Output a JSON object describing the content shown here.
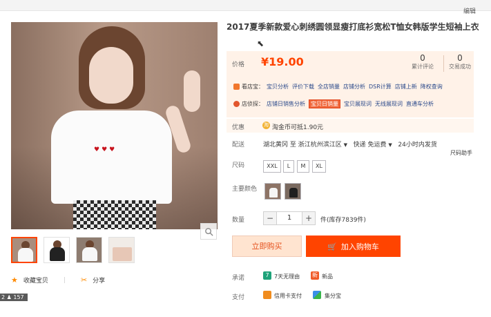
{
  "header": {
    "edit_link": "编辑"
  },
  "gallery": {
    "hearts": "♥♥♥",
    "thumbnails": [
      "thumb-1",
      "thumb-2",
      "thumb-3",
      "thumb-4"
    ]
  },
  "actions": {
    "favorite": "收藏宝贝",
    "share": "分享"
  },
  "overlay_badge": "2 ♟ 157",
  "product": {
    "title": "2017夏季新款爱心刺绣圆领显瘦打底衫宽松T恤女韩版学生短袖上衣"
  },
  "pricing": {
    "label": "价格",
    "value": "¥19.00",
    "reviews": {
      "count": "0",
      "label": "累计评论"
    },
    "sales": {
      "count": "0",
      "label": "交易成功"
    }
  },
  "promo": {
    "row1": {
      "prefix": "看店宝：",
      "links": [
        "宝贝分析",
        "评价下载",
        "全店销量",
        "店铺分析",
        "DSR计算",
        "店铺上新",
        "降权查询"
      ]
    },
    "row2": {
      "prefix": "店侦探：",
      "links": [
        "店铺日销售分析",
        "宝贝日销量",
        "宝贝展现词",
        "无线展现词",
        "直通车分析"
      ],
      "highlighted": "宝贝日销量"
    }
  },
  "coupon": {
    "label": "优惠",
    "coin": "淘",
    "text": "淘金币可抵1.90元"
  },
  "shipping": {
    "label": "配送",
    "from": "湖北黄冈",
    "to_prefix": "至",
    "to": "浙江杭州滨江区",
    "method": "快递 免运费",
    "promise": "24小时内发货"
  },
  "helper_text": "尺码助手",
  "size": {
    "label": "尺码",
    "options": [
      "XXL",
      "L",
      "M",
      "XL"
    ]
  },
  "color": {
    "label": "主要颜色"
  },
  "quantity": {
    "label": "数量",
    "minus": "−",
    "value": "1",
    "plus": "+",
    "stock": "件(库存7839件)"
  },
  "buttons": {
    "buy_now": "立即购买",
    "add_to_cart": "加入购物车",
    "cart_glyph": "🛒"
  },
  "promise": {
    "label": "承诺",
    "icon1": "7",
    "item1": "7天无理由",
    "icon2": "新",
    "item2": "新品"
  },
  "payment": {
    "label": "支付",
    "item1": "信用卡支付",
    "item2": "集分宝"
  },
  "colors": {
    "accent": "#ff4400",
    "price": "#ff4400",
    "price_bg": "#fff2e8"
  }
}
